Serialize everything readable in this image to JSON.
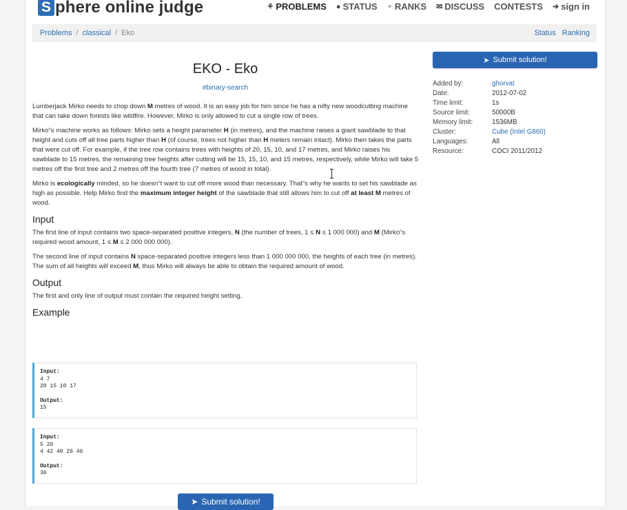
{
  "header": {
    "logo_letter": "S",
    "logo_text": "phere online judge",
    "nav": [
      {
        "icon": "sitemap-icon",
        "glyph": "⚘",
        "label": "PROBLEMS"
      },
      {
        "icon": "circle-icon",
        "glyph": "●",
        "label": "STATUS"
      },
      {
        "icon": "trophy-icon",
        "glyph": "♆",
        "label": "RANKS"
      },
      {
        "icon": "comments-icon",
        "glyph": "✉",
        "label": "DISCUSS"
      },
      {
        "icon": "",
        "glyph": "",
        "label": "CONTESTS"
      },
      {
        "icon": "sign-in-icon",
        "glyph": "➜",
        "label": "sign in"
      }
    ]
  },
  "breadcrumb": {
    "items": [
      "Problems",
      "classical",
      "Eko"
    ],
    "separator": "/",
    "right_links": [
      "Status",
      "Ranking"
    ]
  },
  "problem": {
    "title": "EKO - Eko",
    "tag": "#binary-search",
    "p1": {
      "a": "Lumberjack Mirko needs to chop down ",
      "b": "M",
      "c": " metres of wood. It is an easy job for him since he has a nifty new woodcutting machine that can take down forests like wildfire. However, Mirko is only allowed to cut a single row of trees."
    },
    "p2": {
      "a": "Mirko“s machine works as follows: Mirko sets a height parameter ",
      "b": "H",
      "c": " (in metres), and the machine raises a giant sawblade to that height and cuts off all tree parts higher than ",
      "d": "H",
      "e": " (of course, trees not higher than ",
      "f": "H",
      "g": " meters remain intact). Mirko then takes the parts that were cut off. For example, if the tree row contains trees with heights of 20, 15, 10, and 17 metres, and Mirko raises his sawblade to 15 metres, the remaining tree heights after cutting will be 15, 15, 10, and 15 metres, respectively, while Mirko will take 5 metres off the first tree and 2 metres off the fourth tree (7 metres of wood in total)."
    },
    "p3": {
      "a": "Mirko is ",
      "b": "ecologically",
      "c": " minded, so he doesn“t want to cut off more wood than necessary. That“s why he wants to set his sawblade as high as possible. Help Mirko find the ",
      "d": "maximum integer height",
      "e": " of the sawblade that still allows him to cut off ",
      "f": "at least M",
      "g": " metres of wood."
    },
    "input_heading": "Input",
    "input1": {
      "a": "The first line of input contains two space-separated positive integers, ",
      "b": "N",
      "c": " (the number of trees, 1 ≤ ",
      "d": "N",
      "e": " ≤ 1 000 000) and ",
      "f": "M",
      "g": " (Mirko“s required wood amount, 1 ≤ ",
      "h": "M",
      "i": " ≤ 2 000 000 000)."
    },
    "input2": {
      "a": "The second line of input contains ",
      "b": "N",
      "c": " space-separated positive integers less than 1 000 000 000, the heights of each tree (in metres). The sum of all heights will exceed ",
      "d": "M",
      "e": ", thus Mirko will always be able to obtain the required amount of wood."
    },
    "output_heading": "Output",
    "output_text": "The first and only line of output must contain the required height setting.",
    "example_heading": "Example",
    "examples": [
      {
        "input_label": "Input:",
        "input": "4 7\n20 15 10 17",
        "output_label": "Output:",
        "output": "15"
      },
      {
        "input_label": "Input:",
        "input": "5 20\n4 42 40 26 46",
        "output_label": "Output:",
        "output": "36"
      }
    ],
    "submit_bottom": "Submit solution!"
  },
  "sidebar": {
    "submit": "Submit solution!",
    "info": [
      {
        "k": "Added by:",
        "v": "ghorvat"
      },
      {
        "k": "Date:",
        "v": "2012-07-02"
      },
      {
        "k": "Time limit:",
        "v": "1s"
      },
      {
        "k": "Source limit:",
        "v": "50000B"
      },
      {
        "k": "Memory limit:",
        "v": "1536MB"
      },
      {
        "k": "Cluster:",
        "v": "Cube (Intel G860)"
      },
      {
        "k": "Languages:",
        "v": "All"
      },
      {
        "k": "Resource:",
        "v": "COCI 2011/2012"
      }
    ]
  },
  "colors": {
    "accent": "#2a65b3",
    "link": "#2a6db0",
    "example_border": "#4fa7cf"
  }
}
